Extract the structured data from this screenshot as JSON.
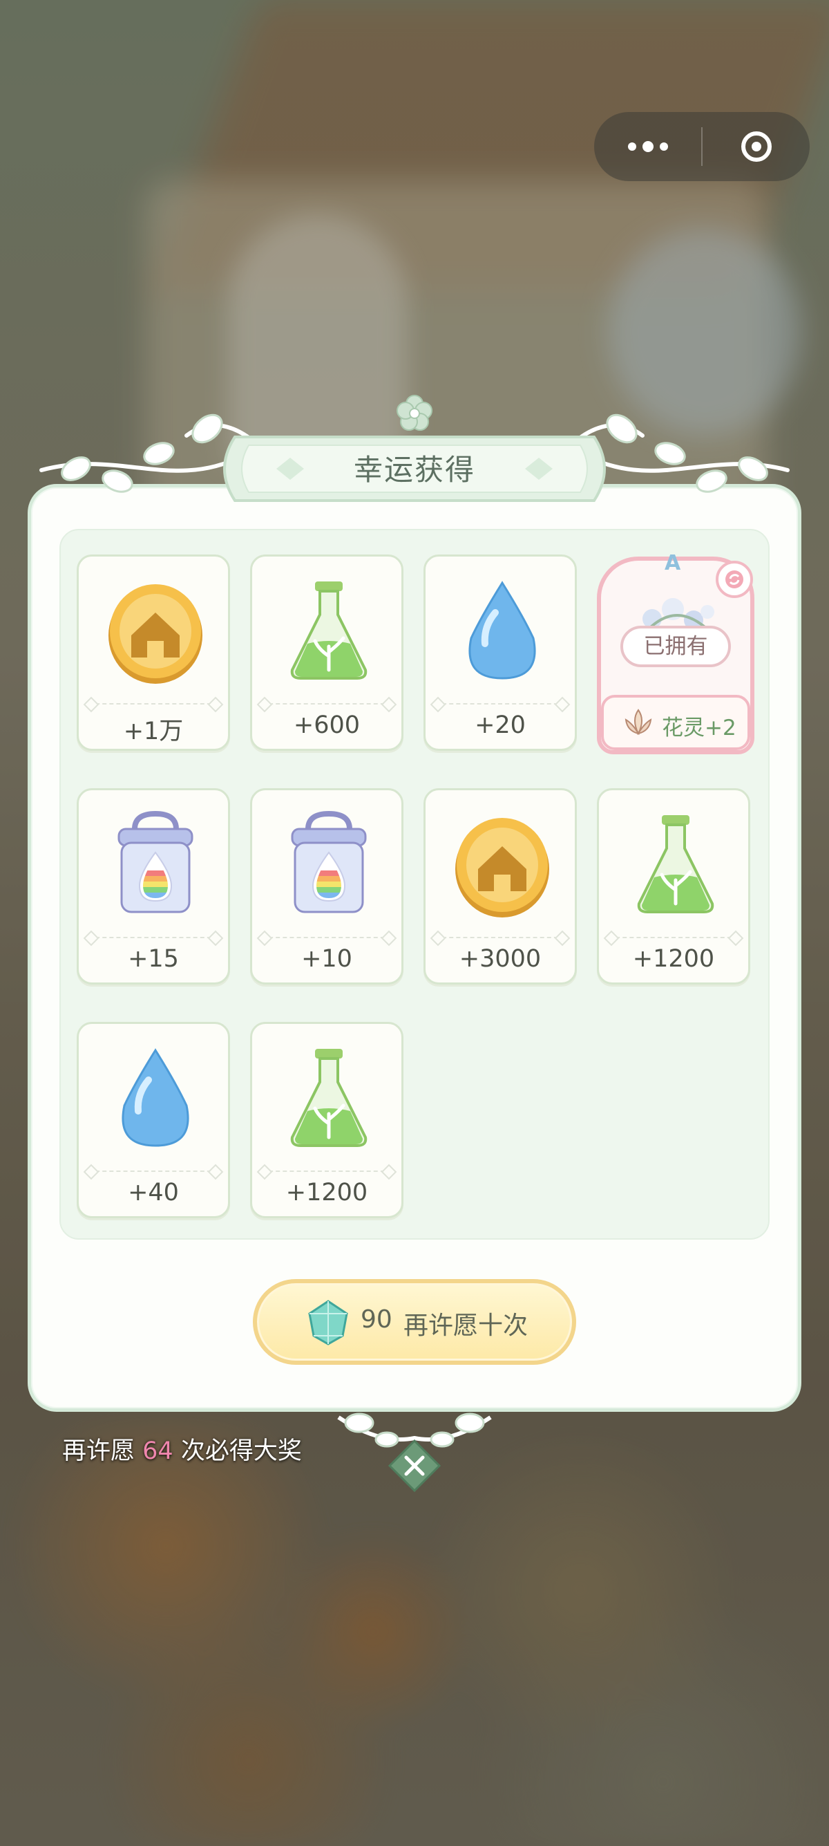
{
  "dialog": {
    "title": "幸运获得",
    "rewards": [
      {
        "icon": "gold-house-coin-icon",
        "amount": "+1万"
      },
      {
        "icon": "green-potion-flask-icon",
        "amount": "+600"
      },
      {
        "icon": "water-drop-icon",
        "amount": "+20"
      },
      {
        "icon": "rainbow-dye-jar-icon",
        "amount": "+15"
      },
      {
        "icon": "rainbow-dye-jar-icon",
        "amount": "+10"
      },
      {
        "icon": "gold-house-coin-icon",
        "amount": "+3000"
      },
      {
        "icon": "green-potion-flask-icon",
        "amount": "+1200"
      },
      {
        "icon": "water-drop-icon",
        "amount": "+40"
      },
      {
        "icon": "green-potion-flask-icon",
        "amount": "+1200"
      }
    ],
    "spirit_card": {
      "grade": "A",
      "status": "已拥有",
      "label": "花灵+2",
      "icon": "flower-spirit-icon"
    },
    "wish_again": {
      "cost": "90",
      "label": "再许愿十次",
      "icon": "crystal-gem-icon"
    }
  },
  "pity": {
    "prefix": "再许愿",
    "count": "64",
    "suffix": "次必得大奖"
  },
  "colors": {
    "accent_green": "#d5ead9",
    "pink_frame": "#f2b9c3",
    "gold_button": "#f3d58b",
    "pity_number": "#ef86ad"
  }
}
